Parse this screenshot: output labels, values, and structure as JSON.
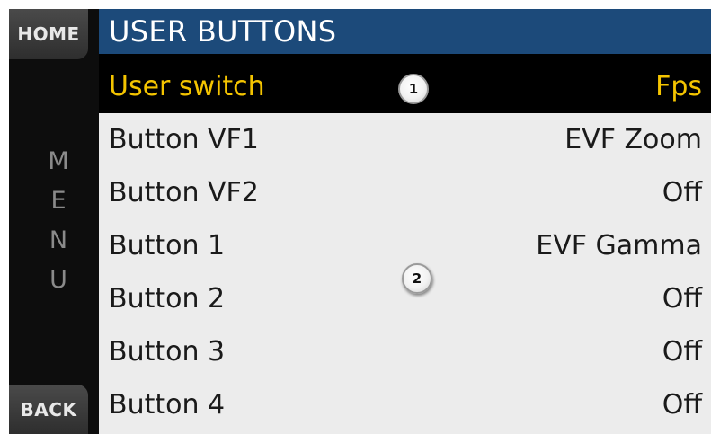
{
  "sidebar": {
    "home_label": "HOME",
    "menu_letters": [
      "M",
      "E",
      "N",
      "U"
    ],
    "back_label": "BACK"
  },
  "header": {
    "title": "USER BUTTONS"
  },
  "rows": [
    {
      "label": "User switch",
      "value": "Fps",
      "selected": true
    },
    {
      "label": "Button VF1",
      "value": "EVF Zoom",
      "selected": false
    },
    {
      "label": "Button VF2",
      "value": "Off",
      "selected": false
    },
    {
      "label": "Button 1",
      "value": "EVF Gamma",
      "selected": false
    },
    {
      "label": "Button 2",
      "value": "Off",
      "selected": false
    },
    {
      "label": "Button 3",
      "value": "Off",
      "selected": false
    },
    {
      "label": "Button 4",
      "value": "Off",
      "selected": false
    }
  ],
  "callouts": [
    "1",
    "2"
  ],
  "colors": {
    "header_bg": "#1c4a7a",
    "selected_text": "#f4c400",
    "list_bg": "#ececec"
  }
}
